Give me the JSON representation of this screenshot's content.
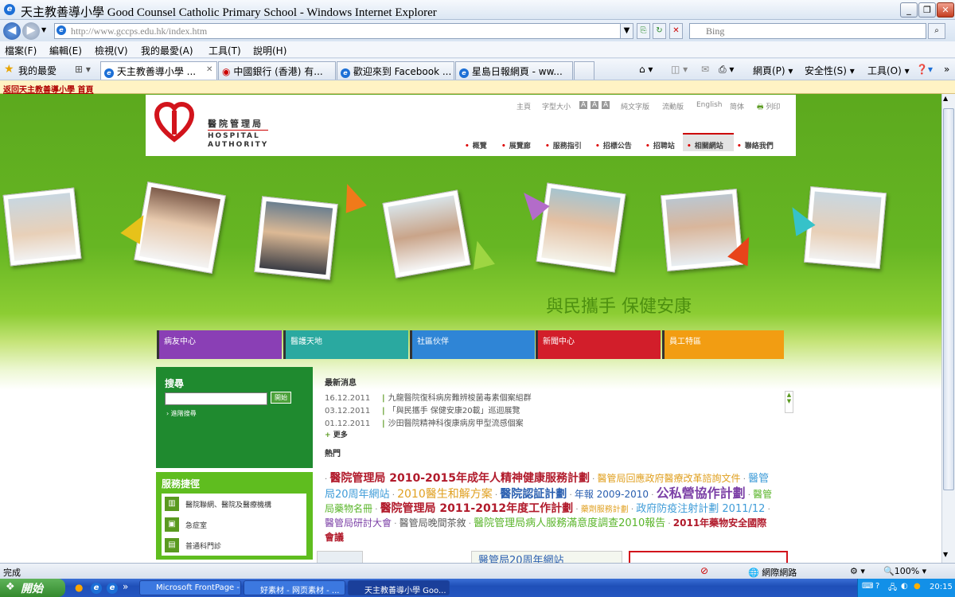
{
  "window": {
    "title": "天主教善導小學 Good Counsel Catholic Primary School - Windows Internet Explorer"
  },
  "address": {
    "url": "http://www.gccps.edu.hk/index.htm",
    "search_placeholder": "Bing"
  },
  "menu": [
    "檔案(F)",
    "編輯(E)",
    "檢視(V)",
    "我的最愛(A)",
    "工具(T)",
    "說明(H)"
  ],
  "favorites_label": "我的最愛",
  "tabs": [
    "天主教善導小學 ...",
    "中國銀行 (香港) 有...",
    "歡迎來到 Facebook ...",
    "星島日報網頁 - ww..."
  ],
  "commands": {
    "page": "網頁(P)",
    "safety": "安全性(S)",
    "tools": "工具(O)"
  },
  "infobar": {
    "link": "返回天主教善導小學 首頁"
  },
  "site": {
    "logo_zh": "醫院管理局",
    "logo_en": [
      "HOSPITAL",
      "AUTHORITY"
    ],
    "toplinks": {
      "home": "主頁",
      "fontsize": "字型大小",
      "sizes": [
        "A",
        "A",
        "A"
      ],
      "text_version": "純文字版",
      "mobile": "流動版",
      "english": "English",
      "simplified": "简体",
      "print": "列印"
    },
    "nav": [
      "概覽",
      "展覽廊",
      "服務指引",
      "招標公告",
      "招聘站",
      "相關網站",
      "聯絡我們"
    ],
    "slogan": "與民攜手 保健安康",
    "color_tabs": [
      "病友中心",
      "醫護天地",
      "社區伙伴",
      "新聞中心",
      "員工特區"
    ],
    "search": {
      "title": "搜尋",
      "button": "開始",
      "advanced": "進階搜尋"
    },
    "services": {
      "title": "服務捷徑",
      "items": [
        "醫院聯網、醫院及醫療機構",
        "急症室",
        "普通科門診"
      ]
    },
    "news_title": "最新消息",
    "news": [
      {
        "date": "16.12.2011",
        "text": "九龍醫院復科病房難辨梭菌毒素個案組群"
      },
      {
        "date": "03.12.2011",
        "text": "「與民攜手 保健安康20載」巡迴展覽"
      },
      {
        "date": "01.12.2011",
        "text": "沙田醫院精神科復康病房甲型流感個案"
      }
    ],
    "news_more": "更多",
    "hot_title": "熱門",
    "hot": [
      {
        "text": "醫院管理局 2010-2015年成年人精神健康服務計劃",
        "color": "#b11a2b"
      },
      {
        "text": "醫管局回應政府醫療改革諮詢文件",
        "color": "#e0a020"
      },
      {
        "text": "醫管局20周年網站",
        "color": "#3f9cd8"
      },
      {
        "text": "2010醫生和解方案",
        "color": "#e0a020"
      },
      {
        "text": "醫院認証計劃",
        "color": "#2a5fb0"
      },
      {
        "text": "年報 2009-2010",
        "color": "#2a5fb0"
      },
      {
        "text": "公私營協作計劃",
        "color": "#7b3fa6"
      },
      {
        "text": "醫管局藥物名冊",
        "color": "#5ab52a"
      },
      {
        "text": "醫院管理局 2011-2012年度工作計劃",
        "color": "#b11a2b"
      },
      {
        "text": "藥劑服務計劃",
        "color": "#e0a020"
      },
      {
        "text": "政府防疫注射計劃 2011/12",
        "color": "#3f9cd8"
      },
      {
        "text": "醫管局研討大會",
        "color": "#7b3fa6"
      },
      {
        "text": "醫管局晚間茶敘",
        "color": "#5a5a5a"
      },
      {
        "text": "醫院管理局病人服務滿意度調查2010報告",
        "color": "#5ab52a"
      },
      {
        "text": "2011年藥物安全國際會議",
        "color": "#b11a2b"
      }
    ],
    "banner_partial": "醫管局20周年網站"
  },
  "status": {
    "text": "完成",
    "zone": "網際網路",
    "zoom": "100%"
  },
  "taskbar": {
    "start": "開始",
    "items": [
      "Microsoft FrontPage - ...",
      "好素材 - 网页素材 - ...",
      "天主教善導小學 Goo..."
    ],
    "clock": "20:15"
  }
}
